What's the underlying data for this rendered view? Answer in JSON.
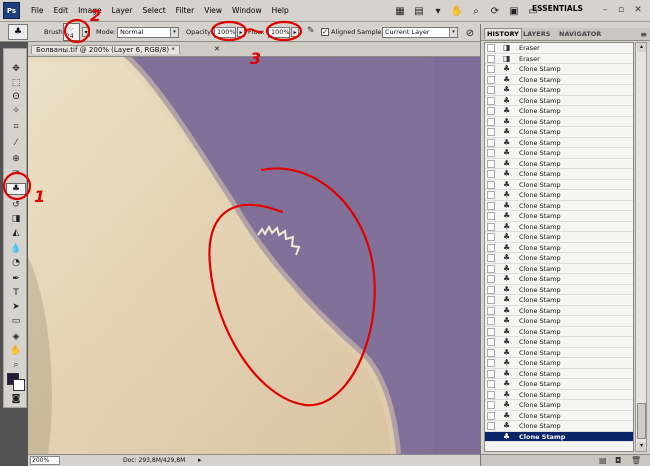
{
  "menubar": {
    "items": [
      "File",
      "Edit",
      "Image",
      "Layer",
      "Select",
      "Filter",
      "View",
      "Window",
      "Help"
    ],
    "workspace": "ESSENTIALS",
    "logo": "Ps"
  },
  "options": {
    "brush_label": "Brush:",
    "brush_size": "24",
    "mode_label": "Mode:",
    "mode_value": "Normal",
    "opacity_label": "Opacity:",
    "opacity_value": "100%",
    "flow_label": "Flow:",
    "flow_value": "100%",
    "aligned_label": "Aligned",
    "sample_label": "Sample:",
    "sample_value": "Current Layer"
  },
  "document": {
    "title": "Болваны.tif @ 200% (Layer 6, RGB/8) *",
    "zoom": "200%",
    "doc_info": "Doc: 293,8M/429,8M"
  },
  "history": {
    "tabs": [
      "HISTORY",
      "LAYERS",
      "NAVIGATOR"
    ],
    "items": [
      {
        "label": "Eraser",
        "icon": "eraser-icon"
      },
      {
        "label": "Eraser",
        "icon": "eraser-icon"
      },
      {
        "label": "Clone Stamp",
        "icon": "clone-stamp-icon"
      },
      {
        "label": "Clone Stamp",
        "icon": "clone-stamp-icon"
      },
      {
        "label": "Clone Stamp",
        "icon": "clone-stamp-icon"
      },
      {
        "label": "Clone Stamp",
        "icon": "clone-stamp-icon"
      },
      {
        "label": "Clone Stamp",
        "icon": "clone-stamp-icon"
      },
      {
        "label": "Clone Stamp",
        "icon": "clone-stamp-icon"
      },
      {
        "label": "Clone Stamp",
        "icon": "clone-stamp-icon"
      },
      {
        "label": "Clone Stamp",
        "icon": "clone-stamp-icon"
      },
      {
        "label": "Clone Stamp",
        "icon": "clone-stamp-icon"
      },
      {
        "label": "Clone Stamp",
        "icon": "clone-stamp-icon"
      },
      {
        "label": "Clone Stamp",
        "icon": "clone-stamp-icon"
      },
      {
        "label": "Clone Stamp",
        "icon": "clone-stamp-icon"
      },
      {
        "label": "Clone Stamp",
        "icon": "clone-stamp-icon"
      },
      {
        "label": "Clone Stamp",
        "icon": "clone-stamp-icon"
      },
      {
        "label": "Clone Stamp",
        "icon": "clone-stamp-icon"
      },
      {
        "label": "Clone Stamp",
        "icon": "clone-stamp-icon"
      },
      {
        "label": "Clone Stamp",
        "icon": "clone-stamp-icon"
      },
      {
        "label": "Clone Stamp",
        "icon": "clone-stamp-icon"
      },
      {
        "label": "Clone Stamp",
        "icon": "clone-stamp-icon"
      },
      {
        "label": "Clone Stamp",
        "icon": "clone-stamp-icon"
      },
      {
        "label": "Clone Stamp",
        "icon": "clone-stamp-icon"
      },
      {
        "label": "Clone Stamp",
        "icon": "clone-stamp-icon"
      },
      {
        "label": "Clone Stamp",
        "icon": "clone-stamp-icon"
      },
      {
        "label": "Clone Stamp",
        "icon": "clone-stamp-icon"
      },
      {
        "label": "Clone Stamp",
        "icon": "clone-stamp-icon"
      },
      {
        "label": "Clone Stamp",
        "icon": "clone-stamp-icon"
      },
      {
        "label": "Clone Stamp",
        "icon": "clone-stamp-icon"
      },
      {
        "label": "Clone Stamp",
        "icon": "clone-stamp-icon"
      },
      {
        "label": "Clone Stamp",
        "icon": "clone-stamp-icon"
      },
      {
        "label": "Clone Stamp",
        "icon": "clone-stamp-icon"
      },
      {
        "label": "Clone Stamp",
        "icon": "clone-stamp-icon"
      },
      {
        "label": "Clone Stamp",
        "icon": "clone-stamp-icon"
      },
      {
        "label": "Clone Stamp",
        "icon": "clone-stamp-icon"
      },
      {
        "label": "Clone Stamp",
        "icon": "clone-stamp-icon"
      },
      {
        "label": "Clone Stamp",
        "icon": "clone-stamp-icon"
      },
      {
        "label": "Clone Stamp",
        "icon": "clone-stamp-icon",
        "current": true
      }
    ]
  },
  "annotations": {
    "labels": [
      "1",
      "2",
      "3"
    ],
    "color": "#e00000"
  },
  "colors": {
    "canvas_purple": "#7d6c97",
    "skin": "#e7d6b8",
    "history_selected": "#0a246a",
    "foreground": "#241b39"
  }
}
